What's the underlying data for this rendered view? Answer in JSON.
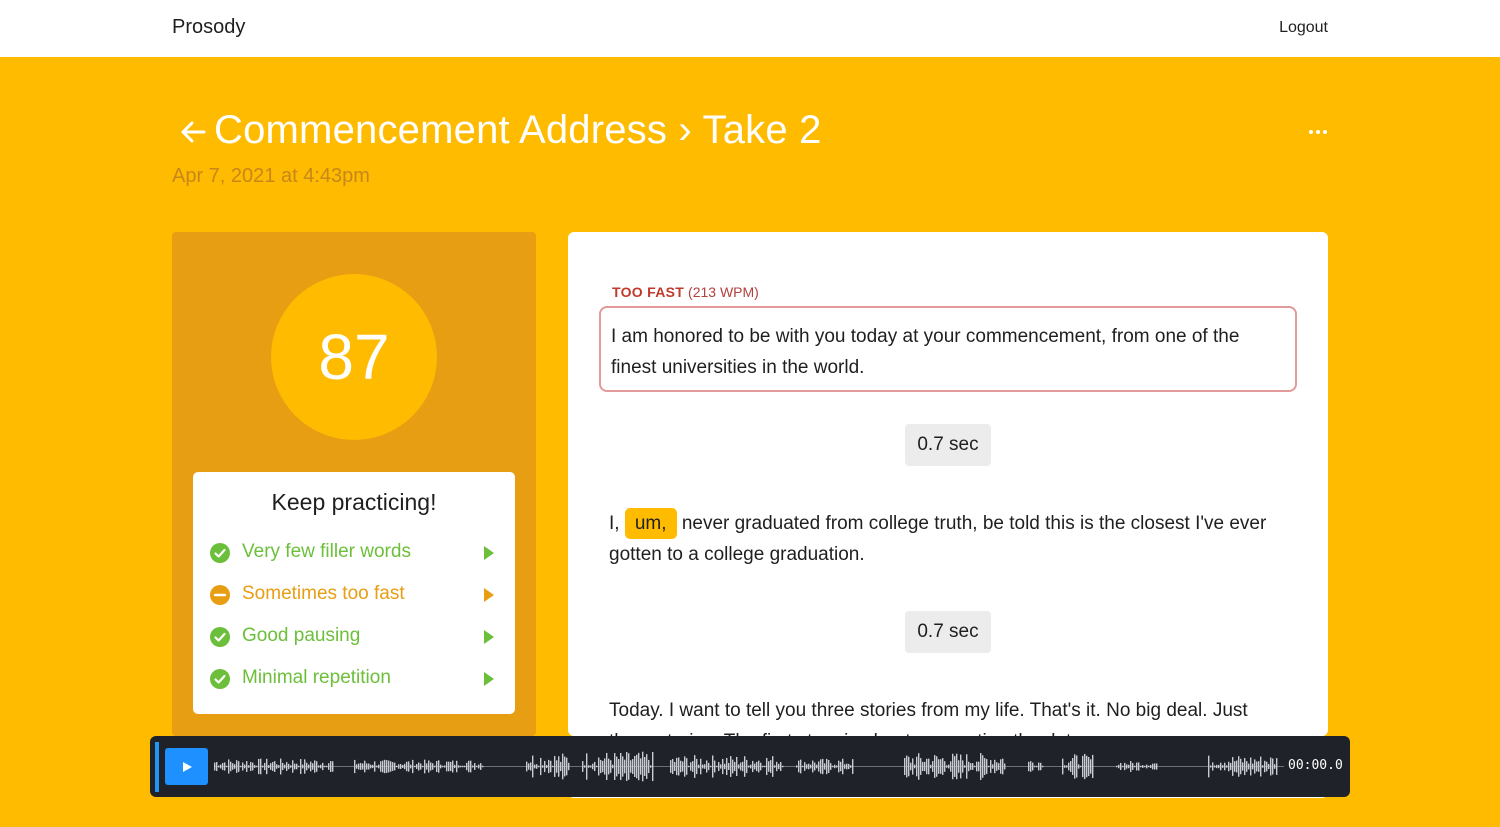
{
  "app": {
    "brand": "Prosody",
    "logout_label": "Logout"
  },
  "header": {
    "back_icon": "arrow-left-icon",
    "title": "Commencement Address › Take 2",
    "date": "Apr 7, 2021 at 4:43pm",
    "more_icon": "ellipsis-icon"
  },
  "score": {
    "value": "87",
    "card_title": "Keep practicing!",
    "items": [
      {
        "label": "Very few filler words",
        "status": "good",
        "icon": "check-circle-icon"
      },
      {
        "label": "Sometimes too fast",
        "status": "warning",
        "icon": "minus-circle-icon"
      },
      {
        "label": "Good pausing",
        "status": "good",
        "icon": "check-circle-icon"
      },
      {
        "label": "Minimal repetition",
        "status": "good",
        "icon": "check-circle-icon"
      }
    ]
  },
  "transcript": {
    "warning_label": "TOO FAST",
    "warning_detail": "(213 WPM)",
    "sentence_1": "I am honored to be with you today at your commencement, from one of the finest universities in the world.",
    "pause_1": "0.7 sec",
    "sentence_2_prefix": "I,",
    "sentence_2_filler": "um,",
    "sentence_2_rest": "never graduated from college truth, be told this is the closest I've ever gotten to a college graduation.",
    "pause_2": "0.7 sec",
    "sentence_3": "Today. I want to tell you three stories from my life. That's it. No big deal.",
    "sentence_4_partial": "Just three stories. The first story is about connecting the dots."
  },
  "player": {
    "play_icon": "play-icon",
    "time": "00:00.0",
    "progress": 0.0
  },
  "colors": {
    "background": "#ffbb00",
    "panel": "#e89e12",
    "good": "#6cbf3a",
    "warning": "#e89e12",
    "too_fast": "#c0392b",
    "player_bg": "#1f2228",
    "play_button": "#1e90ff"
  }
}
